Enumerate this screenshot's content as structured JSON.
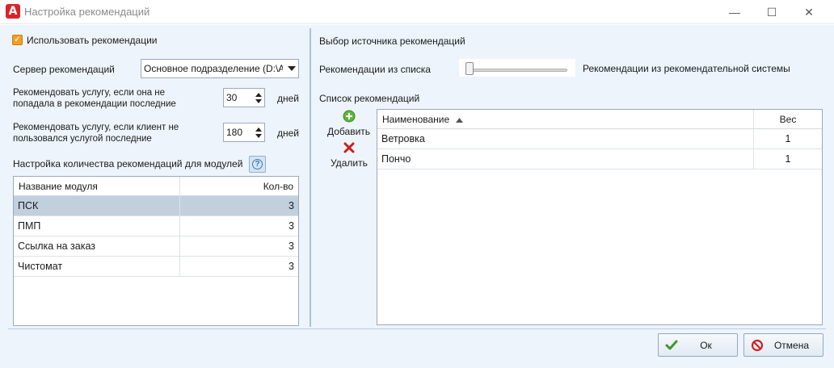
{
  "window": {
    "title": "Настройка рекомендаций",
    "minimize_glyph": "—",
    "maximize_glyph": "☐",
    "close_glyph": "✕"
  },
  "left": {
    "use_recommendations_label": "Использовать рекомендации",
    "use_recommendations_checked": true,
    "server_label": "Сервер рекомендаций",
    "server_value": "Основное подразделение (D:\\A",
    "recommend_if_not_in_label": "Рекомендовать услугу, если она не попадала в рекомендации последние",
    "recommend_if_not_in_value": "30",
    "recommend_if_not_in_unit": "дней",
    "recommend_if_not_used_label": "Рекомендовать услугу, если клиент не пользовался услугой последние",
    "recommend_if_not_used_value": "180",
    "recommend_if_not_used_unit": "дней",
    "modules_section_label": "Настройка количества рекомендаций для модулей",
    "modules_table": {
      "col_name": "Название модуля",
      "col_count": "Кол-во",
      "rows": [
        {
          "name": "ПСК",
          "count": "3"
        },
        {
          "name": "ПМП",
          "count": "3"
        },
        {
          "name": "Ссылка на заказ",
          "count": "3"
        },
        {
          "name": "Чистомат",
          "count": "3"
        }
      ]
    }
  },
  "right": {
    "source_title": "Выбор источника рекомендаций",
    "from_list_label": "Рекомендации из списка",
    "from_system_label": "Рекомендации из рекомендательной системы",
    "list_title": "Список рекомендаций",
    "add_label": "Добавить",
    "delete_label": "Удалить",
    "table": {
      "col_name": "Наименование",
      "col_weight": "Вес",
      "rows": [
        {
          "name": "Ветровка",
          "weight": "1"
        },
        {
          "name": "Пончо",
          "weight": "1"
        }
      ]
    }
  },
  "footer": {
    "ok_label": "Ок",
    "cancel_label": "Отмена"
  },
  "colors": {
    "accent_orange": "#f0a020",
    "selected_row": "#c2d0dd",
    "client_bg": "#eef4fb",
    "app_icon_red": "#d9232a"
  },
  "icons": [
    "app-logo-icon",
    "checkmark-icon",
    "chevron-down-icon",
    "spin-up-icon",
    "spin-down-icon",
    "help-icon",
    "sort-ascending-icon",
    "add-circle-icon",
    "delete-x-icon",
    "ok-check-icon",
    "cancel-circle-icon"
  ]
}
